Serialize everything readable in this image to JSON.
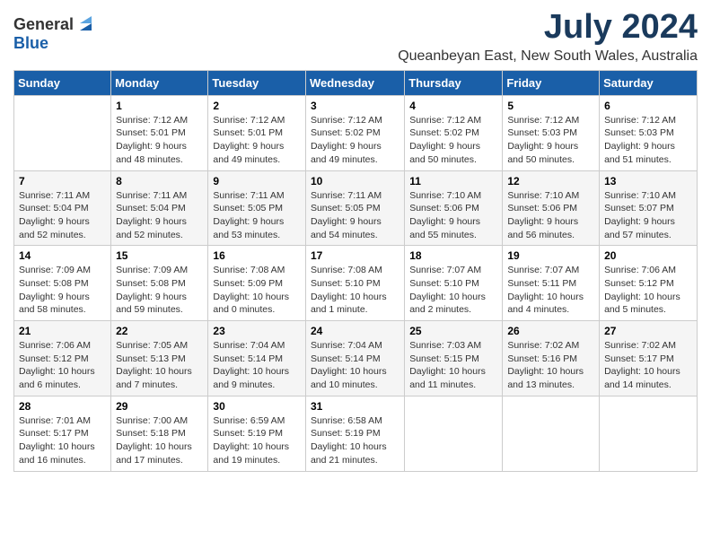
{
  "logo": {
    "general": "General",
    "blue": "Blue"
  },
  "title": "July 2024",
  "subtitle": "Queanbeyan East, New South Wales, Australia",
  "columns": [
    "Sunday",
    "Monday",
    "Tuesday",
    "Wednesday",
    "Thursday",
    "Friday",
    "Saturday"
  ],
  "weeks": [
    [
      {
        "day": "",
        "info": ""
      },
      {
        "day": "1",
        "info": "Sunrise: 7:12 AM\nSunset: 5:01 PM\nDaylight: 9 hours\nand 48 minutes."
      },
      {
        "day": "2",
        "info": "Sunrise: 7:12 AM\nSunset: 5:01 PM\nDaylight: 9 hours\nand 49 minutes."
      },
      {
        "day": "3",
        "info": "Sunrise: 7:12 AM\nSunset: 5:02 PM\nDaylight: 9 hours\nand 49 minutes."
      },
      {
        "day": "4",
        "info": "Sunrise: 7:12 AM\nSunset: 5:02 PM\nDaylight: 9 hours\nand 50 minutes."
      },
      {
        "day": "5",
        "info": "Sunrise: 7:12 AM\nSunset: 5:03 PM\nDaylight: 9 hours\nand 50 minutes."
      },
      {
        "day": "6",
        "info": "Sunrise: 7:12 AM\nSunset: 5:03 PM\nDaylight: 9 hours\nand 51 minutes."
      }
    ],
    [
      {
        "day": "7",
        "info": "Sunrise: 7:11 AM\nSunset: 5:04 PM\nDaylight: 9 hours\nand 52 minutes."
      },
      {
        "day": "8",
        "info": "Sunrise: 7:11 AM\nSunset: 5:04 PM\nDaylight: 9 hours\nand 52 minutes."
      },
      {
        "day": "9",
        "info": "Sunrise: 7:11 AM\nSunset: 5:05 PM\nDaylight: 9 hours\nand 53 minutes."
      },
      {
        "day": "10",
        "info": "Sunrise: 7:11 AM\nSunset: 5:05 PM\nDaylight: 9 hours\nand 54 minutes."
      },
      {
        "day": "11",
        "info": "Sunrise: 7:10 AM\nSunset: 5:06 PM\nDaylight: 9 hours\nand 55 minutes."
      },
      {
        "day": "12",
        "info": "Sunrise: 7:10 AM\nSunset: 5:06 PM\nDaylight: 9 hours\nand 56 minutes."
      },
      {
        "day": "13",
        "info": "Sunrise: 7:10 AM\nSunset: 5:07 PM\nDaylight: 9 hours\nand 57 minutes."
      }
    ],
    [
      {
        "day": "14",
        "info": "Sunrise: 7:09 AM\nSunset: 5:08 PM\nDaylight: 9 hours\nand 58 minutes."
      },
      {
        "day": "15",
        "info": "Sunrise: 7:09 AM\nSunset: 5:08 PM\nDaylight: 9 hours\nand 59 minutes."
      },
      {
        "day": "16",
        "info": "Sunrise: 7:08 AM\nSunset: 5:09 PM\nDaylight: 10 hours\nand 0 minutes."
      },
      {
        "day": "17",
        "info": "Sunrise: 7:08 AM\nSunset: 5:10 PM\nDaylight: 10 hours\nand 1 minute."
      },
      {
        "day": "18",
        "info": "Sunrise: 7:07 AM\nSunset: 5:10 PM\nDaylight: 10 hours\nand 2 minutes."
      },
      {
        "day": "19",
        "info": "Sunrise: 7:07 AM\nSunset: 5:11 PM\nDaylight: 10 hours\nand 4 minutes."
      },
      {
        "day": "20",
        "info": "Sunrise: 7:06 AM\nSunset: 5:12 PM\nDaylight: 10 hours\nand 5 minutes."
      }
    ],
    [
      {
        "day": "21",
        "info": "Sunrise: 7:06 AM\nSunset: 5:12 PM\nDaylight: 10 hours\nand 6 minutes."
      },
      {
        "day": "22",
        "info": "Sunrise: 7:05 AM\nSunset: 5:13 PM\nDaylight: 10 hours\nand 7 minutes."
      },
      {
        "day": "23",
        "info": "Sunrise: 7:04 AM\nSunset: 5:14 PM\nDaylight: 10 hours\nand 9 minutes."
      },
      {
        "day": "24",
        "info": "Sunrise: 7:04 AM\nSunset: 5:14 PM\nDaylight: 10 hours\nand 10 minutes."
      },
      {
        "day": "25",
        "info": "Sunrise: 7:03 AM\nSunset: 5:15 PM\nDaylight: 10 hours\nand 11 minutes."
      },
      {
        "day": "26",
        "info": "Sunrise: 7:02 AM\nSunset: 5:16 PM\nDaylight: 10 hours\nand 13 minutes."
      },
      {
        "day": "27",
        "info": "Sunrise: 7:02 AM\nSunset: 5:17 PM\nDaylight: 10 hours\nand 14 minutes."
      }
    ],
    [
      {
        "day": "28",
        "info": "Sunrise: 7:01 AM\nSunset: 5:17 PM\nDaylight: 10 hours\nand 16 minutes."
      },
      {
        "day": "29",
        "info": "Sunrise: 7:00 AM\nSunset: 5:18 PM\nDaylight: 10 hours\nand 17 minutes."
      },
      {
        "day": "30",
        "info": "Sunrise: 6:59 AM\nSunset: 5:19 PM\nDaylight: 10 hours\nand 19 minutes."
      },
      {
        "day": "31",
        "info": "Sunrise: 6:58 AM\nSunset: 5:19 PM\nDaylight: 10 hours\nand 21 minutes."
      },
      {
        "day": "",
        "info": ""
      },
      {
        "day": "",
        "info": ""
      },
      {
        "day": "",
        "info": ""
      }
    ]
  ]
}
